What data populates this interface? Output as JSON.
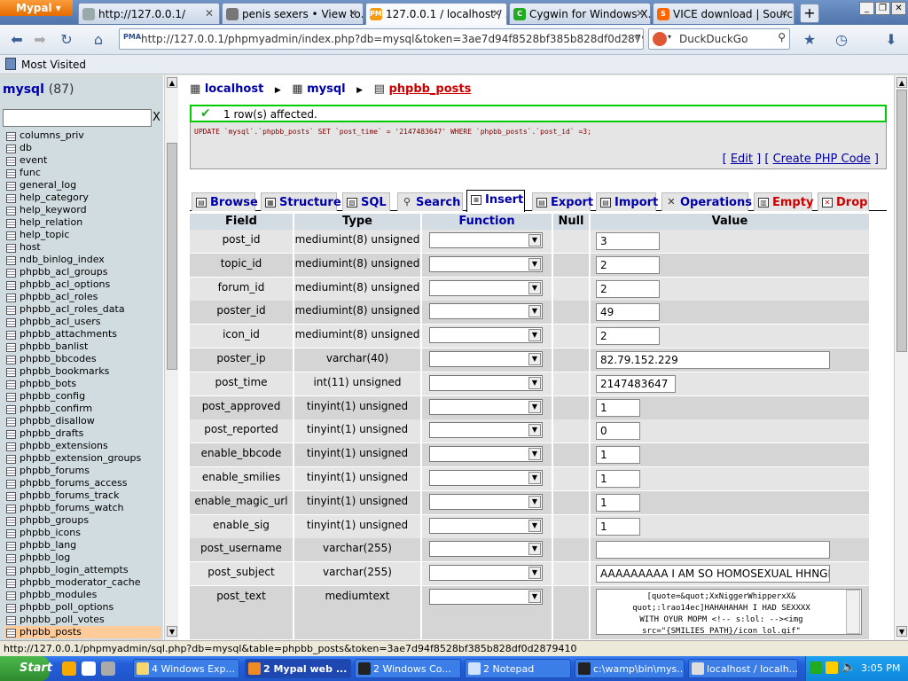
{
  "browser": {
    "app_button": "Mypal",
    "tabs": [
      {
        "label": "http://127.0.0.1/",
        "icon": "page-icon",
        "active": false
      },
      {
        "label": "penis sexers • View to...",
        "icon": "globe-icon",
        "active": false
      },
      {
        "label": "127.0.0.1 / localhost / ...",
        "icon": "pma-icon",
        "active": true
      },
      {
        "label": "Cygwin for Windows X...",
        "icon": "cygwin-icon",
        "active": false
      },
      {
        "label": "VICE download | Sourc...",
        "icon": "sourceforge-icon",
        "active": false
      }
    ],
    "new_tab": "+",
    "url": "http://127.0.0.1/phpmyadmin/index.php?db=mysql&token=3ae7d94f8528bf385b828df0d2879410",
    "url_favicon": "PMA",
    "search_engine": "DuckDuckGo",
    "bookmarks_bar": "Most Visited",
    "status_url": "http://127.0.0.1/phpmyadmin/sql.php?db=mysql&table=phpbb_posts&token=3ae7d94f8528bf385b828df0d2879410"
  },
  "left_panel": {
    "db_name": "mysql",
    "db_count": "(87)",
    "filter_placeholder": "",
    "filter_clear": "X",
    "tables": [
      "columns_priv",
      "db",
      "event",
      "func",
      "general_log",
      "help_category",
      "help_keyword",
      "help_relation",
      "help_topic",
      "host",
      "ndb_binlog_index",
      "phpbb_acl_groups",
      "phpbb_acl_options",
      "phpbb_acl_roles",
      "phpbb_acl_roles_data",
      "phpbb_acl_users",
      "phpbb_attachments",
      "phpbb_banlist",
      "phpbb_bbcodes",
      "phpbb_bookmarks",
      "phpbb_bots",
      "phpbb_config",
      "phpbb_confirm",
      "phpbb_disallow",
      "phpbb_drafts",
      "phpbb_extensions",
      "phpbb_extension_groups",
      "phpbb_forums",
      "phpbb_forums_access",
      "phpbb_forums_track",
      "phpbb_forums_watch",
      "phpbb_groups",
      "phpbb_icons",
      "phpbb_lang",
      "phpbb_log",
      "phpbb_login_attempts",
      "phpbb_moderator_cache",
      "phpbb_modules",
      "phpbb_poll_options",
      "phpbb_poll_votes",
      "phpbb_posts"
    ],
    "selected_table": "phpbb_posts"
  },
  "breadcrumb": {
    "server": "localhost",
    "database": "mysql",
    "table": "phpbb_posts"
  },
  "message": {
    "text": "1 row(s) affected."
  },
  "sql": {
    "query": "UPDATE `mysql`.`phpbb_posts` SET `post_time` = '2147483647' WHERE `phpbb_posts`.`post_id` =3;",
    "edit": "Edit",
    "create_php": "Create PHP Code",
    "bracket_open": "[",
    "bracket_close": "]"
  },
  "tabs": [
    {
      "label": "Browse",
      "icon": "browse-icon"
    },
    {
      "label": "Structure",
      "icon": "structure-icon"
    },
    {
      "label": "SQL",
      "icon": "sql-icon"
    },
    {
      "label": "Search",
      "icon": "search-icon"
    },
    {
      "label": "Insert",
      "icon": "insert-icon"
    },
    {
      "label": "Export",
      "icon": "export-icon"
    },
    {
      "label": "Import",
      "icon": "import-icon"
    },
    {
      "label": "Operations",
      "icon": "operations-icon"
    },
    {
      "label": "Empty",
      "icon": "empty-icon"
    },
    {
      "label": "Drop",
      "icon": "drop-icon"
    }
  ],
  "active_tab": "Insert",
  "grid": {
    "headers": {
      "field": "Field",
      "type": "Type",
      "function": "Function",
      "null": "Null",
      "value": "Value"
    },
    "rows": [
      {
        "field": "post_id",
        "type": "mediumint(8) unsigned",
        "value": "3"
      },
      {
        "field": "topic_id",
        "type": "mediumint(8) unsigned",
        "value": "2"
      },
      {
        "field": "forum_id",
        "type": "mediumint(8) unsigned",
        "value": "2"
      },
      {
        "field": "poster_id",
        "type": "mediumint(8) unsigned",
        "value": "49"
      },
      {
        "field": "icon_id",
        "type": "mediumint(8) unsigned",
        "value": "2"
      },
      {
        "field": "poster_ip",
        "type": "varchar(40)",
        "value": "82.79.152.229"
      },
      {
        "field": "post_time",
        "type": "int(11) unsigned",
        "value": "2147483647"
      },
      {
        "field": "post_approved",
        "type": "tinyint(1) unsigned",
        "value": "1"
      },
      {
        "field": "post_reported",
        "type": "tinyint(1) unsigned",
        "value": "0"
      },
      {
        "field": "enable_bbcode",
        "type": "tinyint(1) unsigned",
        "value": "1"
      },
      {
        "field": "enable_smilies",
        "type": "tinyint(1) unsigned",
        "value": "1"
      },
      {
        "field": "enable_magic_url",
        "type": "tinyint(1) unsigned",
        "value": "1"
      },
      {
        "field": "enable_sig",
        "type": "tinyint(1) unsigned",
        "value": "1"
      },
      {
        "field": "post_username",
        "type": "varchar(255)",
        "value": ""
      },
      {
        "field": "post_subject",
        "type": "varchar(255)",
        "value": "AAAAAAAAA I AM SO HOMOSEXUAL HHNGNNG"
      },
      {
        "field": "post_text",
        "type": "mediumtext",
        "value": "[quote=&quot;XxNiggerWhipperxX&\nquot;:lrao14ec]HAHAHAHAH I HAD SEXXXX\nWITH OYUR MOPM <!-- s:lol: --><img\nsrc=\"{SMILIES_PATH}/icon_lol.gif\""
      }
    ]
  },
  "taskbar": {
    "start": "Start",
    "tasks": [
      {
        "label": "4 Windows Exp...",
        "active": false
      },
      {
        "label": "2 Mypal web ...",
        "active": true
      },
      {
        "label": "2 Windows Co...",
        "active": false
      },
      {
        "label": "2 Notepad",
        "active": false
      },
      {
        "label": "c:\\wamp\\bin\\mys...",
        "active": false
      },
      {
        "label": "localhost / localh...",
        "active": false
      }
    ],
    "clock": "3:05 PM"
  },
  "colors": {
    "accent_link": "#0000aa",
    "table_red": "#cc0000",
    "success_border": "#00cc00",
    "selected_row": "#ffcc99"
  }
}
